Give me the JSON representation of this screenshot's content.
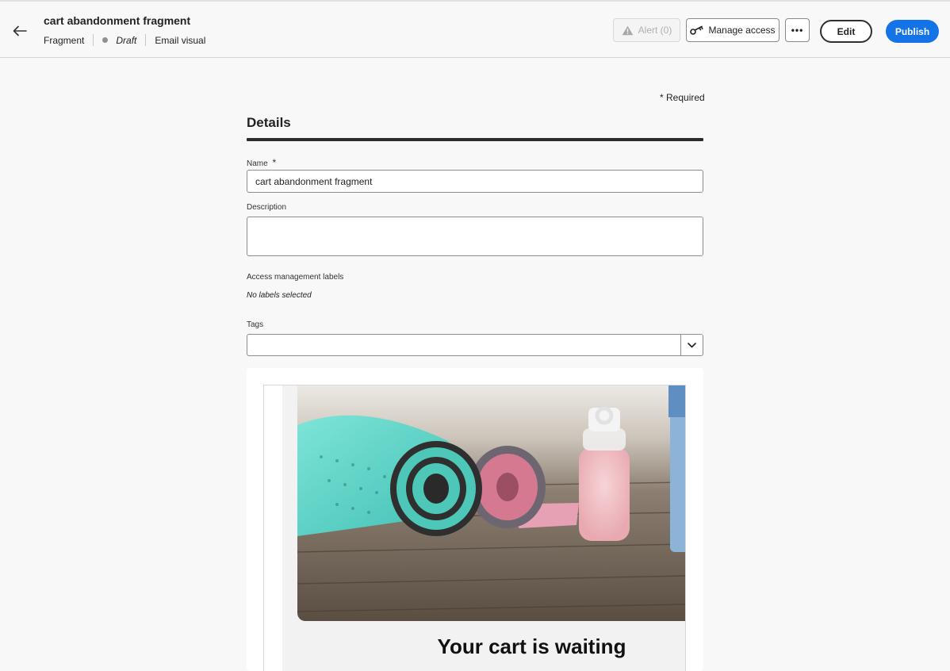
{
  "header": {
    "title": "cart abandonment fragment",
    "type": "Fragment",
    "status": "Draft",
    "channel": "Email visual",
    "alert_label": "Alert (0)",
    "manage_access_label": "Manage access",
    "more_label": "•••",
    "edit_label": "Edit",
    "publish_label": "Publish",
    "publish_color": "#1473e6"
  },
  "form": {
    "required_note": "* Required",
    "section_title": "Details",
    "name_label": "Name",
    "name_required_mark": "*",
    "name_value": "cart abandonment fragment",
    "description_label": "Description",
    "description_value": "",
    "access_labels_label": "Access management labels",
    "access_labels_value": "No labels selected",
    "tags_label": "Tags",
    "tags_value": ""
  },
  "preview": {
    "hero_image": "yoga-mats-and-water-bottles-photo",
    "heading": "Your cart is waiting"
  },
  "icons": {
    "back": "arrow-left-icon",
    "alert": "alert-triangle-icon",
    "manage_access": "key-icon",
    "more": "more-horizontal-icon",
    "tags_dropdown": "chevron-down-icon"
  }
}
